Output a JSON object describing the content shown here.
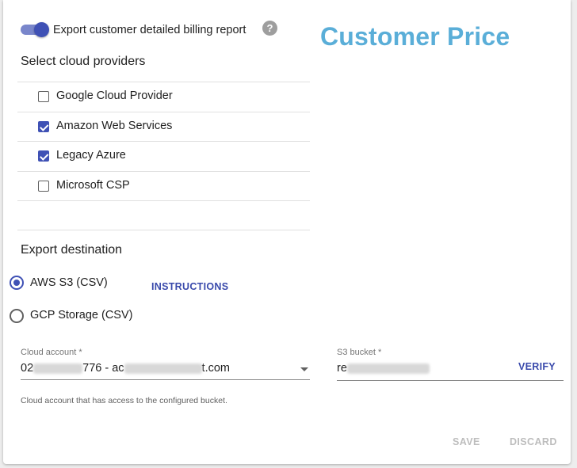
{
  "export_toggle": {
    "label": "Export customer detailed billing report",
    "enabled": true
  },
  "help_icon": "question-circle-icon",
  "page_title": "Customer Price",
  "providers": {
    "title": "Select cloud providers",
    "items": [
      {
        "label": "Google Cloud Provider",
        "checked": false
      },
      {
        "label": "Amazon Web Services",
        "checked": true
      },
      {
        "label": "Legacy Azure",
        "checked": true
      },
      {
        "label": "Microsoft CSP",
        "checked": false
      }
    ]
  },
  "destination": {
    "title": "Export destination",
    "options": [
      {
        "label": "AWS S3 (CSV)",
        "selected": true
      },
      {
        "label": "GCP Storage (CSV)",
        "selected": false
      }
    ],
    "instructions_label": "INSTRUCTIONS"
  },
  "cloud_account": {
    "label": "Cloud account *",
    "value_prefix": "02",
    "value_mid": "776 - ac",
    "value_suffix": "t.com",
    "hint": "Cloud account that has access to the configured bucket."
  },
  "s3_bucket": {
    "label": "S3 bucket *",
    "value_prefix": "re",
    "verify_label": "VERIFY"
  },
  "actions": {
    "save_label": "SAVE",
    "discard_label": "DISCARD"
  },
  "colors": {
    "accent": "#3f51b5",
    "title_blue": "#5aaed8",
    "disabled": "#bdbdbd"
  }
}
